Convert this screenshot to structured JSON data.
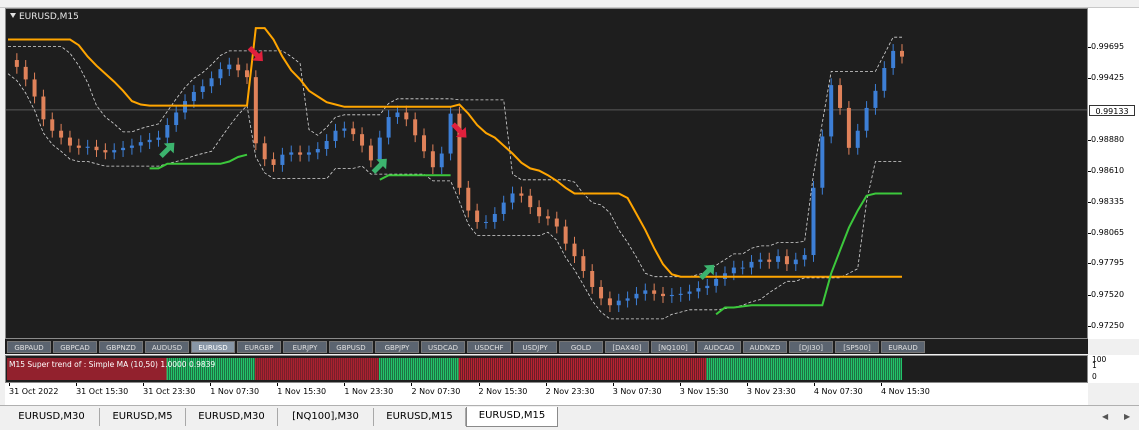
{
  "window": {
    "title": "EURUSD,M15"
  },
  "price_axis": {
    "ticks": [
      "0.99695",
      "0.99425",
      "0.99133",
      "0.98880",
      "0.98610",
      "0.98335",
      "0.98065",
      "0.97795",
      "0.97520",
      "0.97250"
    ],
    "current_price": "0.99133"
  },
  "symbol_bar": [
    "GBPAUD",
    "GBPCAD",
    "GBPNZD",
    "AUDUSD",
    "EURUSD",
    "EURGBP",
    "EURJPY",
    "GBPUSD",
    "GBPJPY",
    "USDCAD",
    "USDCHF",
    "USDJPY",
    "GOLD",
    "[DAX40]",
    "[NQ100]",
    "AUDCAD",
    "AUDNZD",
    "[DJI30]",
    "[SP500]",
    "EURAUD"
  ],
  "symbol_bar_active": "EURUSD",
  "indicator": {
    "label": "M15  Super trend of :  Simple MA (10,50)  1.0000 0.9839",
    "axis_ticks": [
      "100",
      "1",
      "0"
    ]
  },
  "date_axis": [
    "31 Oct 2022",
    "31 Oct 15:30",
    "31 Oct 23:30",
    "1 Nov 07:30",
    "1 Nov 15:30",
    "1 Nov 23:30",
    "2 Nov 07:30",
    "2 Nov 15:30",
    "2 Nov 23:30",
    "3 Nov 07:30",
    "3 Nov 15:30",
    "3 Nov 23:30",
    "4 Nov 07:30",
    "4 Nov 15:30"
  ],
  "tabs": [
    "EURUSD,M30",
    "EURUSD,M5",
    "EURUSD,M30",
    "[NQ100],M30",
    "EURUSD,M15",
    "EURUSD,M15"
  ],
  "active_tab": 5,
  "colors": {
    "background": "#1e1e1e",
    "bull_candle": "#3d7fd6",
    "bear_candle": "#e0825a",
    "upper_band": "#ffa500",
    "lower_band": "#3cc83c",
    "channel": "#d8d8d8",
    "buy_arrow": "#3cb46e",
    "sell_arrow": "#e0203c",
    "indicator_bull": "#22c46a",
    "indicator_bear": "#b82232"
  },
  "chart_data": {
    "type": "line",
    "series": [
      {
        "values": [
          0.9957,
          0.9951,
          0.994,
          0.9925,
          0.9905,
          0.9895,
          0.9889,
          0.9882,
          0.988,
          0.9881,
          0.9878,
          0.9876,
          0.9878,
          0.988,
          0.9882,
          0.9885,
          0.9887,
          0.9889,
          0.99,
          0.9911,
          0.9921,
          0.9929,
          0.9934,
          0.9941,
          0.9949,
          0.9953,
          0.9948,
          0.9942,
          0.9884,
          0.987,
          0.9865,
          0.9874,
          0.9876,
          0.9874,
          0.9876,
          0.9879,
          0.9886,
          0.9895,
          0.9897,
          0.9892,
          0.9882,
          0.9869,
          0.9889,
          0.9907,
          0.9911,
          0.9905,
          0.9891,
          0.9877,
          0.9863,
          0.9875,
          0.991,
          0.9845,
          0.9825,
          0.9815,
          0.9815,
          0.9822,
          0.9832,
          0.984,
          0.9838,
          0.9828,
          0.982,
          0.9818,
          0.9811,
          0.9796,
          0.9785,
          0.9772,
          0.9758,
          0.9748,
          0.9742,
          0.9746,
          0.9748,
          0.9752,
          0.9755,
          0.9752,
          0.975,
          0.9751,
          0.9752,
          0.9754,
          0.9757,
          0.9759,
          0.9765,
          0.977,
          0.9775,
          0.9775,
          0.978,
          0.9782,
          0.978,
          0.9785,
          0.9778,
          0.9782,
          0.9786,
          0.9845,
          0.989,
          0.9935,
          0.9915,
          0.988,
          0.9895,
          0.9915,
          0.993,
          0.995,
          0.9965,
          0.996
        ]
      },
      {
        "values": [
          0.9975,
          0.9975,
          0.9975,
          0.9975,
          0.9975,
          0.9975,
          0.9975,
          0.9975,
          0.997,
          0.996,
          0.9952,
          0.9945,
          0.9938,
          0.993,
          0.9921,
          0.9918,
          0.9917,
          0.9917,
          0.9917,
          0.9917,
          0.9917,
          0.9917,
          0.9917,
          0.9917,
          0.9917,
          0.9917,
          0.9917,
          0.9917,
          0.9985,
          0.9985,
          0.9975,
          0.996,
          0.9948,
          0.994,
          0.993,
          0.9925,
          0.992,
          0.9918,
          0.9916,
          0.9916,
          0.9916,
          0.9916,
          0.9916,
          0.9916,
          0.9916,
          0.9916,
          0.9916,
          0.9916,
          0.9916,
          0.9916,
          0.9916,
          0.9918,
          0.991,
          0.99,
          0.9893,
          0.9889,
          0.9882,
          0.9875,
          0.9867,
          0.9862,
          0.986,
          0.9856,
          0.9851,
          0.9845,
          0.984,
          0.984,
          0.984,
          0.984,
          0.984,
          0.984,
          0.9836,
          0.9822,
          0.9808,
          0.9792,
          0.9778,
          0.9769,
          0.9767,
          0.9767,
          0.9767,
          0.9767,
          0.9767,
          0.9767,
          0.9767,
          0.9767,
          0.9767,
          0.9767,
          0.9767,
          0.9767,
          0.9767,
          0.9767,
          0.9767,
          0.9767,
          0.9767,
          0.9767,
          0.9767,
          0.9767,
          0.9767,
          0.9767,
          0.9767,
          0.9767,
          0.9767,
          0.9767
        ]
      },
      {
        "values": [
          null,
          null,
          null,
          null,
          null,
          null,
          null,
          null,
          null,
          null,
          null,
          null,
          null,
          null,
          null,
          null,
          0.9862,
          0.9862,
          0.9866,
          0.9866,
          0.9866,
          0.9866,
          0.9866,
          0.9866,
          0.9866,
          0.9868,
          0.9872,
          0.9874,
          null,
          null,
          null,
          null,
          null,
          null,
          null,
          null,
          null,
          null,
          null,
          null,
          null,
          null,
          0.9852,
          0.9856,
          0.9856,
          0.9856,
          0.9856,
          0.9856,
          0.9856,
          0.9856,
          0.9856,
          null,
          null,
          null,
          null,
          null,
          null,
          null,
          null,
          null,
          null,
          null,
          null,
          null,
          null,
          null,
          null,
          null,
          null,
          null,
          null,
          null,
          null,
          null,
          null,
          null,
          null,
          null,
          null,
          null,
          0.9734,
          0.974,
          0.974,
          0.9741,
          0.9742,
          0.9742,
          0.9742,
          0.9742,
          0.9742,
          0.9742,
          0.9742,
          0.9742,
          0.9742,
          0.977,
          0.979,
          0.981,
          0.9825,
          0.9838,
          0.984,
          0.984,
          0.984,
          0.984
        ]
      }
    ],
    "ylim": [
      0.9715,
      1.0
    ],
    "grid": false,
    "signals": [
      {
        "index": 18,
        "side": "buy"
      },
      {
        "index": 28,
        "side": "sell"
      },
      {
        "index": 42,
        "side": "buy"
      },
      {
        "index": 51,
        "side": "sell"
      },
      {
        "index": 79,
        "side": "buy"
      }
    ],
    "indicator_state": [
      "bear",
      "bull",
      "bear",
      "bull",
      "bear",
      "bull"
    ]
  }
}
